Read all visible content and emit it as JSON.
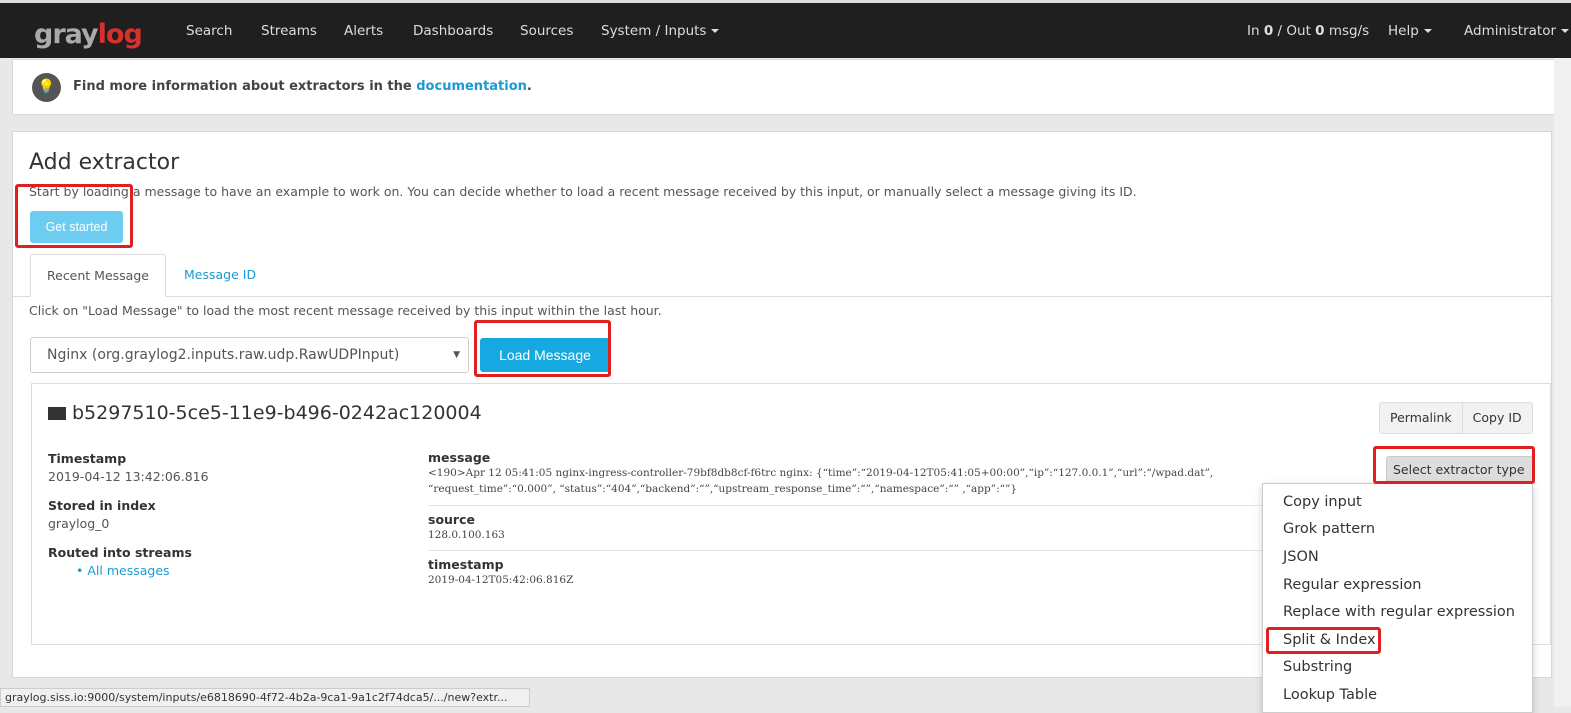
{
  "nav": {
    "logo": "graylog",
    "items": [
      "Search",
      "Streams",
      "Alerts",
      "Dashboards",
      "Sources",
      "System / Inputs"
    ],
    "throughput": {
      "in_label": "In ",
      "in": "0",
      "sep": " / Out ",
      "out": "0",
      "unit": " msg/s"
    },
    "help": "Help",
    "user": "Administrator"
  },
  "info": {
    "icon": "lightbulb-icon",
    "text": "Find more information about extractors in the ",
    "link": "documentation",
    "end": "."
  },
  "extractor": {
    "title": "Add extractor",
    "description": "Start by loading a message to have an example to work on. You can decide whether to load a recent message received by this input, or manually select a message giving its ID.",
    "get_started": "Get started",
    "tabs": [
      "Recent Message",
      "Message ID"
    ],
    "hint": "Click on \"Load Message\" to load the most recent message received by this input within the last hour.",
    "input_select": "Nginx (org.graylog2.inputs.raw.udp.RawUDPInput)",
    "load_button": "Load Message"
  },
  "message": {
    "id": "b5297510-5ce5-11e9-b496-0242ac120004",
    "permalink": "Permalink",
    "copy_id": "Copy ID",
    "meta": {
      "timestamp_label": "Timestamp",
      "timestamp": "2019-04-12 13:42:06.816",
      "index_label": "Stored in index",
      "index": "graylog_0",
      "streams_label": "Routed into streams",
      "stream": "All messages"
    },
    "fields": [
      {
        "name": "message",
        "lines": [
          "<190>Apr 12 05:41:05 nginx-ingress-controller-79bf8db8cf-f6trc nginx: {“time”:“2019-04-12T05:41:05+00:00”,“ip”:“127.0.0.1”,“url”:“/wpad.dat”,",
          "“request_time”:“0.000”, “status”:“404”,“backend”:“”,“upstream_response_time”:“”,“namespace”:“” ,“app”:“”}"
        ]
      },
      {
        "name": "source",
        "lines": [
          "128.0.100.163"
        ]
      },
      {
        "name": "timestamp",
        "lines": [
          "2019-04-12T05:42:06.816Z"
        ]
      }
    ],
    "select_extractor": "Select extractor type",
    "extractor_types": [
      "Copy input",
      "Grok pattern",
      "JSON",
      "Regular expression",
      "Replace with regular expression",
      "Split & Index",
      "Substring",
      "Lookup Table"
    ]
  },
  "status_bar": "graylog.siss.io:9000/system/inputs/e6818690-4f72-4b2a-9ca1-9a1c2f74dca5/.../new?extr...",
  "colors": {
    "nav": "#1f1f1f",
    "accent": "#16a8e0",
    "highlight": "#e02020"
  }
}
